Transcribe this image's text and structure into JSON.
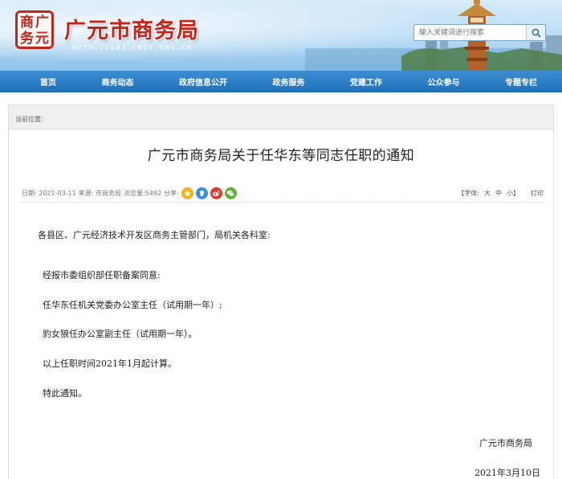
{
  "header": {
    "logo_chars": [
      "商",
      "广",
      "务",
      "元"
    ],
    "site_title": "广元市商务局",
    "site_url": "HTTP://SWJ.CNGY.GOV.CN"
  },
  "search": {
    "placeholder": "输入关键词进行搜索"
  },
  "nav": {
    "items": [
      {
        "label": "首页"
      },
      {
        "label": "商务动态"
      },
      {
        "label": "政府信息公开"
      },
      {
        "label": "政务服务"
      },
      {
        "label": "党建工作"
      },
      {
        "label": "公众参与"
      },
      {
        "label": "专题专栏"
      }
    ]
  },
  "breadcrumb": {
    "label": "当前位置:"
  },
  "article": {
    "title": "广元市商务局关于任华东等同志任职的通知",
    "meta": {
      "date": "日期: 2021-03-11",
      "source": "来源: 市商务局",
      "views": "浏览量:5492",
      "share": "分享:"
    },
    "font_control": {
      "label": "【字体:",
      "large": "大",
      "medium": "中",
      "small": "小】",
      "print": "打印"
    },
    "address": "各县区、广元经济技术开发区商务主管部门，局机关各科室:",
    "paragraphs": [
      "经报市委组织部任职备案同意:",
      "任华东任机关党委办公室主任（试用期一年）;",
      "豹女狼任办公室副主任（试用期一年）。",
      "以上任职时间2021年1月起计算。",
      "特此通知。"
    ],
    "signature": "广元市商务局",
    "sign_date": "2021年3月10日"
  },
  "colors": {
    "brand_red": "#c2261b",
    "nav_blue": "#1f6fb8",
    "share_qzone": "#f2b21b",
    "share_tencent": "#3a8fdc",
    "share_weibo": "#e4352b",
    "share_wechat": "#5fb532"
  }
}
